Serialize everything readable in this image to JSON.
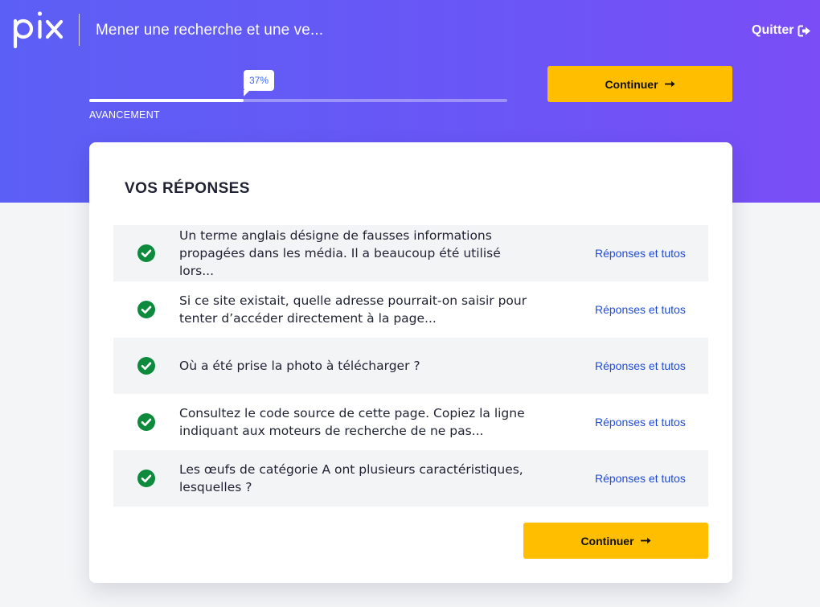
{
  "header": {
    "logo": "pix",
    "title": "Mener une recherche et une ve...",
    "quit_label": "Quitter",
    "quit_icon": "sign-out-icon"
  },
  "progress": {
    "percent": 37,
    "label": "37%",
    "caption": "AVANCEMENT"
  },
  "continue_button": {
    "label": "Continuer",
    "icon": "arrow-right-icon"
  },
  "results": {
    "title": "VOS RÉPONSES",
    "link_label": "Réponses et tutos",
    "status_icon": "check-circle-icon",
    "items": [
      {
        "line1": "Un terme anglais désigne de fausses informations",
        "line2": "propagées dans les média. Il a beaucoup été utilisé lors...",
        "status": "correct"
      },
      {
        "line1": "Si ce site existait, quelle adresse pourrait-on saisir pour",
        "line2": "tenter d’accéder directement à la page...",
        "status": "correct"
      },
      {
        "line1": "Où a été prise la photo à télécharger ?",
        "line2": "",
        "status": "correct"
      },
      {
        "line1": "Consultez le code source de cette page. Copiez la ligne",
        "line2": "indiquant aux moteurs de recherche de ne pas...",
        "status": "correct"
      },
      {
        "line1": "Les œufs de catégorie A ont plusieurs caractéristiques,",
        "line2": "lesquelles ?",
        "status": "correct"
      }
    ]
  },
  "colors": {
    "hero_start": "#5c5ff5",
    "hero_end": "#7a4df7",
    "button": "#ffbe00",
    "success": "#0d8a3c",
    "link": "#1f4bd9"
  }
}
